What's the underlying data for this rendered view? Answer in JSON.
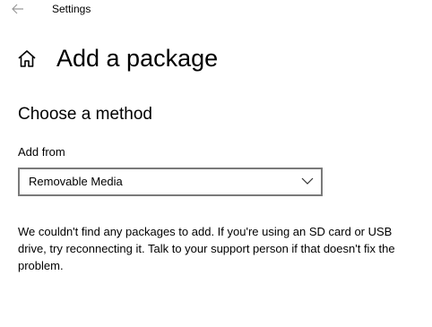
{
  "window": {
    "app_title": "Settings",
    "back_icon": "back-arrow-icon"
  },
  "header": {
    "home_icon": "home-icon",
    "title": "Add a package"
  },
  "method": {
    "section_title": "Choose a method",
    "add_from_label": "Add from",
    "dropdown": {
      "selected": "Removable Media",
      "icon": "chevron-down-icon"
    }
  },
  "message": {
    "text": "We couldn't find any packages to add. If you're using an SD card or USB drive, try reconnecting it. Talk to your support person if that doesn't fix the problem."
  }
}
